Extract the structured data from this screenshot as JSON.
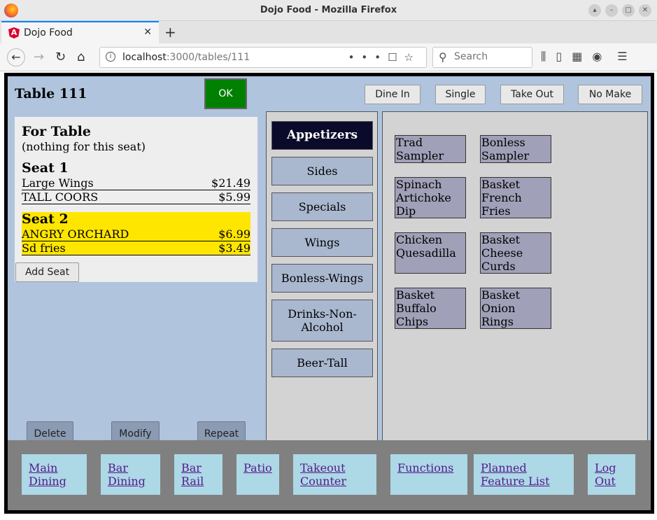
{
  "browser": {
    "window_title": "Dojo Food - Mozilla Firefox",
    "tab_title": "Dojo Food",
    "url_host": "localhost",
    "url_path": ":3000/tables/111",
    "search_placeholder": "Search"
  },
  "header": {
    "table_title": "Table 111",
    "ok_label": "OK",
    "order_types": [
      "Dine In",
      "Single",
      "Take Out",
      "No Make"
    ]
  },
  "order": {
    "for_table": {
      "heading": "For Table",
      "note": "(nothing for this seat)"
    },
    "seats": [
      {
        "heading": "Seat 1",
        "highlight": false,
        "items": [
          {
            "name": "Large Wings",
            "price": "$21.49"
          },
          {
            "name": "TALL COORS",
            "price": "$5.99"
          }
        ]
      },
      {
        "heading": "Seat 2",
        "highlight": true,
        "highlight_color": "#ffe600",
        "items": [
          {
            "name": "ANGRY ORCHARD",
            "price": "$6.99"
          },
          {
            "name": "Sd fries",
            "price": "$3.49"
          }
        ]
      }
    ],
    "add_seat_label": "Add Seat"
  },
  "actions": {
    "delete": "Delete",
    "modify": "Modify",
    "repeat": "Repeat"
  },
  "categories": {
    "active": "Appetizers",
    "items": [
      "Appetizers",
      "Sides",
      "Specials",
      "Wings",
      "Bonless-Wings",
      "Drinks-Non-Alcohol",
      "Beer-Tall"
    ]
  },
  "menu_items": [
    "Trad Sampler",
    "Bonless Sampler",
    "Spinach Artichoke Dip",
    "Basket French Fries",
    "Chicken Quesadilla",
    "Basket Cheese Curds",
    "Basket Buffalo Chips",
    "Basket Onion Rings"
  ],
  "footer_links": [
    "Main Dining",
    "Bar Dining",
    "Bar Rail",
    "Patio",
    "Takeout Counter",
    "Functions",
    "Planned Feature List",
    "Log Out"
  ],
  "colors": {
    "ok_green": "#008000",
    "active_category": "#0a0a2a",
    "background": "#b0c4de",
    "link": "#551a8b",
    "footer_link_bg": "#add8e6"
  }
}
